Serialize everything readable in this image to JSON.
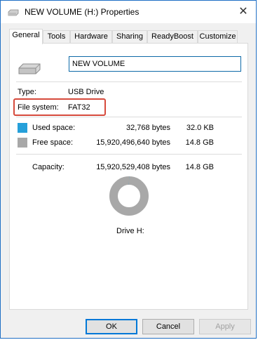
{
  "window": {
    "title": "NEW VOLUME (H:) Properties",
    "close_glyph": "✕"
  },
  "tabs": [
    {
      "label": "General"
    },
    {
      "label": "Tools"
    },
    {
      "label": "Hardware"
    },
    {
      "label": "Sharing"
    },
    {
      "label": "ReadyBoost"
    },
    {
      "label": "Customize"
    }
  ],
  "general": {
    "volume_name": "NEW VOLUME",
    "type_label": "Type:",
    "type_value": "USB Drive",
    "fs_label": "File system:",
    "fs_value": "FAT32",
    "used_label": "Used space:",
    "used_bytes": "32,768 bytes",
    "used_size": "32.0 KB",
    "free_label": "Free space:",
    "free_bytes": "15,920,496,640 bytes",
    "free_size": "14.8 GB",
    "capacity_label": "Capacity:",
    "capacity_bytes": "15,920,529,408 bytes",
    "capacity_size": "14.8 GB",
    "drive_label": "Drive H:",
    "used_color": "#26a0da",
    "free_color": "#a8a8a8"
  },
  "buttons": {
    "ok": "OK",
    "cancel": "Cancel",
    "apply": "Apply"
  }
}
